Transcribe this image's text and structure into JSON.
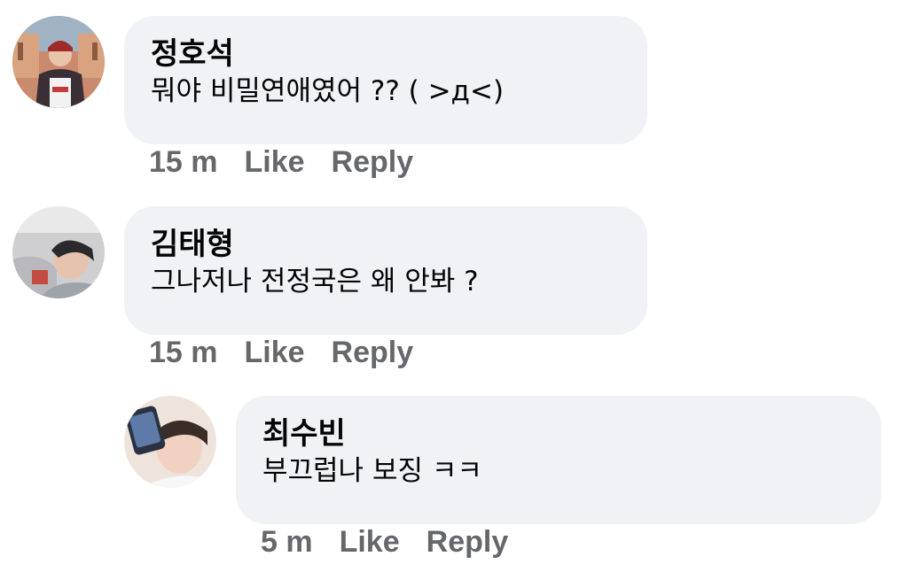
{
  "comments": [
    {
      "author": "정호석",
      "text": "뭐야 비밀연애였어 ?? ( >д<)",
      "time": "15 m",
      "like_label": "Like",
      "reply_label": "Reply",
      "avatar": "avatar-photo"
    },
    {
      "author": "김태형",
      "text": "그나저나 전정국은 왜 안봐 ?",
      "time": "15 m",
      "like_label": "Like",
      "reply_label": "Reply",
      "avatar": "avatar-photo"
    },
    {
      "author": "최수빈",
      "text": "부끄럽나 보징 ㅋㅋ",
      "time": "5 m",
      "like_label": "Like",
      "reply_label": "Reply",
      "avatar": "avatar-photo"
    }
  ],
  "colors": {
    "bubble": "#f0f2f5",
    "meta_text": "#65676b",
    "text": "#050505"
  }
}
